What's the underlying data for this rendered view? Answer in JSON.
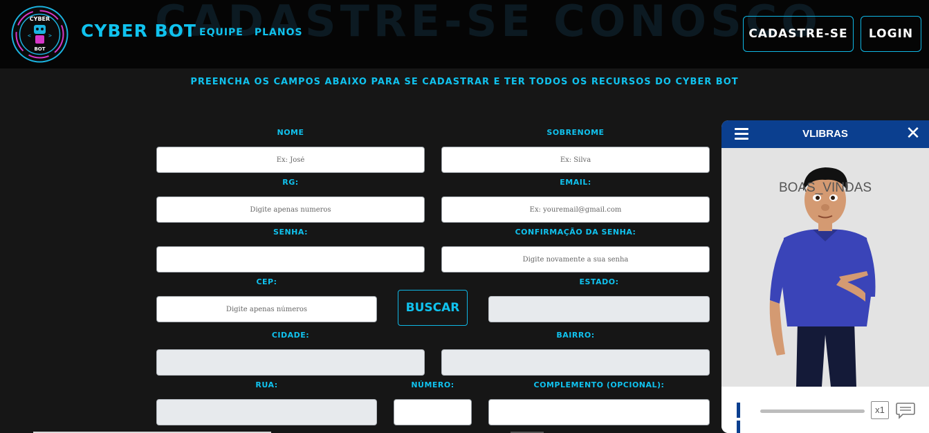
{
  "header": {
    "bg_title": "Cadastre-se conosco",
    "logo_top": "CYBER",
    "logo_bottom": "BOT",
    "brand": "CYBER BOT",
    "nav": [
      "EQUIPE",
      "PLANOS"
    ],
    "cadastre_label": "CADASTRE-SE",
    "login_label": "LOGIN"
  },
  "subtitle": "PREENCHA OS CAMPOS ABAIXO PARA SE CADASTRAR E TER TODOS OS RECURSOS DO CYBER BOT",
  "form": {
    "nome": {
      "label": "NOME",
      "placeholder": "Ex: José"
    },
    "sobrenome": {
      "label": "SOBRENOME",
      "placeholder": "Ex: Silva"
    },
    "rg": {
      "label": "RG:",
      "placeholder": "Digite apenas numeros"
    },
    "email": {
      "label": "EMAIL:",
      "placeholder": "Ex: youremail@gmail.com"
    },
    "senha": {
      "label": "SENHA:",
      "placeholder": ""
    },
    "confirmacao": {
      "label": "CONFIRMAÇÃO DA SENHA:",
      "placeholder": "Digite novamente a sua senha"
    },
    "cep": {
      "label": "CEP:",
      "placeholder": "Digite apenas números"
    },
    "buscar_label": "BUSCAR",
    "estado": {
      "label": "ESTADO:",
      "placeholder": ""
    },
    "cidade": {
      "label": "CIDADE:",
      "placeholder": ""
    },
    "bairro": {
      "label": "BAIRRO:",
      "placeholder": ""
    },
    "rua": {
      "label": "RUA:",
      "placeholder": ""
    },
    "numero": {
      "label": "NÚMERO:",
      "placeholder": ""
    },
    "complemento": {
      "label": "COMPLEMENTO (OPCIONAL):",
      "placeholder": ""
    }
  },
  "vlibras": {
    "title": "VLIBRAS",
    "word": "BOAS_VINDAS",
    "speed": "x1",
    "accent": "#0b3f8f"
  },
  "colors": {
    "accent": "#10c2ee",
    "background": "#161616",
    "header": "#050505"
  }
}
